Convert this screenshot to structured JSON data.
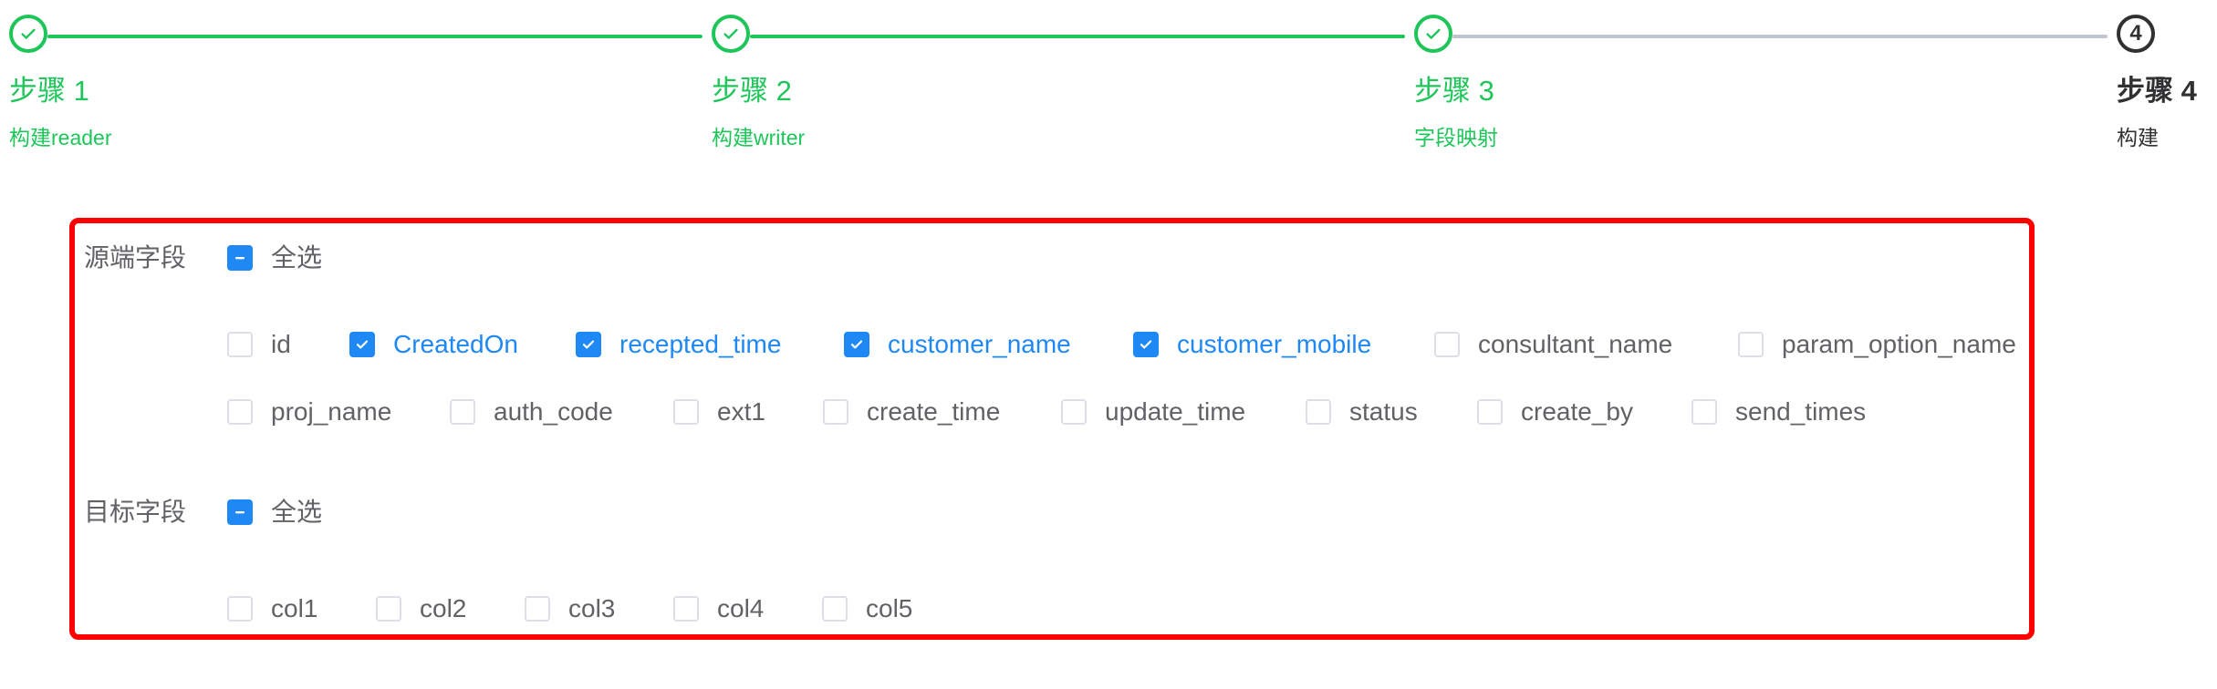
{
  "steps": [
    {
      "title": "步骤 1",
      "desc": "构建reader",
      "status": "done"
    },
    {
      "title": "步骤 2",
      "desc": "构建writer",
      "status": "done"
    },
    {
      "title": "步骤 3",
      "desc": "字段映射",
      "status": "done"
    },
    {
      "title": "步骤 4",
      "desc": "构建",
      "status": "current",
      "number": "4"
    }
  ],
  "source": {
    "label": "源端字段",
    "select_all": {
      "label": "全选",
      "state": "indeterminate"
    },
    "fields": [
      {
        "label": "id",
        "checked": false
      },
      {
        "label": "CreatedOn",
        "checked": true
      },
      {
        "label": "recepted_time",
        "checked": true
      },
      {
        "label": "customer_name",
        "checked": true
      },
      {
        "label": "customer_mobile",
        "checked": true
      },
      {
        "label": "consultant_name",
        "checked": false
      },
      {
        "label": "param_option_name",
        "checked": false
      },
      {
        "label": "proj_name",
        "checked": false
      },
      {
        "label": "auth_code",
        "checked": false
      },
      {
        "label": "ext1",
        "checked": false
      },
      {
        "label": "create_time",
        "checked": false
      },
      {
        "label": "update_time",
        "checked": false
      },
      {
        "label": "status",
        "checked": false
      },
      {
        "label": "create_by",
        "checked": false
      },
      {
        "label": "send_times",
        "checked": false
      }
    ]
  },
  "target": {
    "label": "目标字段",
    "select_all": {
      "label": "全选",
      "state": "indeterminate"
    },
    "fields": [
      {
        "label": "col1",
        "checked": false
      },
      {
        "label": "col2",
        "checked": false
      },
      {
        "label": "col3",
        "checked": false
      },
      {
        "label": "col4",
        "checked": false
      },
      {
        "label": "col5",
        "checked": false
      }
    ]
  },
  "colors": {
    "done": "#1ec65a",
    "current": "#303133",
    "checked": "#1e88f5",
    "highlight_border": "#ff0000"
  },
  "icons": {
    "step_done": "check-icon",
    "checkbox_checked": "check-icon",
    "checkbox_indeterminate": "minus-icon"
  }
}
